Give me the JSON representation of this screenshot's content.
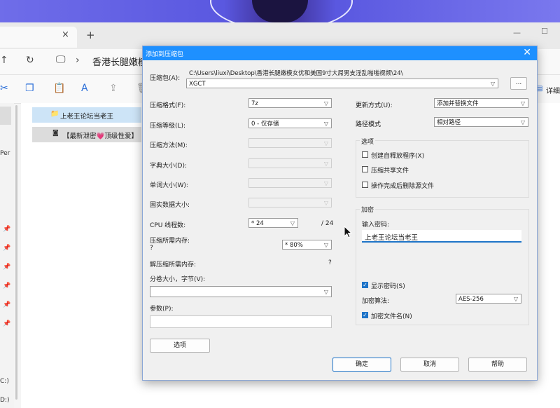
{
  "explorer": {
    "tab_close": "×",
    "new_tab": "+",
    "path": "香港长腿嫩模",
    "details_label": "详细",
    "side_text": "Per",
    "drives": [
      "C:)",
      "D:)"
    ],
    "items": [
      {
        "name": "上老王论坛当老王",
        "icon": "folder-icon"
      },
      {
        "name": "【最新泄密💗顶级性爱】",
        "icon": "file-icon"
      }
    ]
  },
  "dialog": {
    "title": "添加到压缩包",
    "close": "✕",
    "archive_label": "压缩包(A):",
    "archive_dir": "C:\\Users\\liuxi\\Desktop\\香港长腿嫩模女优和美国9寸大屌男支淫乱啪啪视频\\24\\",
    "archive_name": "XGCT",
    "browse": "...",
    "format_label": "压缩格式(F):",
    "format_value": "7z",
    "level_label": "压缩等级(L):",
    "level_value": "0 - 仅存储",
    "method_label": "压缩方法(M):",
    "dict_label": "字典大小(D):",
    "word_label": "单词大小(W):",
    "solid_label": "固实数据大小:",
    "cpu_label": "CPU 线程数:",
    "cpu_value": "* 24",
    "cpu_max": "/ 24",
    "mem_comp_label": "压缩所需内存:",
    "mem_comp_q": "?",
    "mem_comp_value": "* 80%",
    "mem_decomp_label": "解压缩所需内存:",
    "mem_decomp_q": "?",
    "volume_label": "分卷大小，字节(V):",
    "params_label": "参数(P):",
    "options_button": "选项",
    "update_label": "更新方式(U):",
    "update_value": "添加并替换文件",
    "pathmode_label": "路径模式",
    "pathmode_value": "相对路径",
    "options_group": "选项",
    "opt_sfx": "创建自释放程序(X)",
    "opt_shared": "压缩共享文件",
    "opt_delete": "操作完成后删除源文件",
    "encrypt_group": "加密",
    "password_label": "输入密码:",
    "password_value": "上老王论坛当老王",
    "show_password": "显示密码(S)",
    "algo_label": "加密算法:",
    "algo_value": "AES-256",
    "encrypt_names": "加密文件名(N)",
    "ok": "确定",
    "cancel": "取消",
    "help": "帮助"
  }
}
